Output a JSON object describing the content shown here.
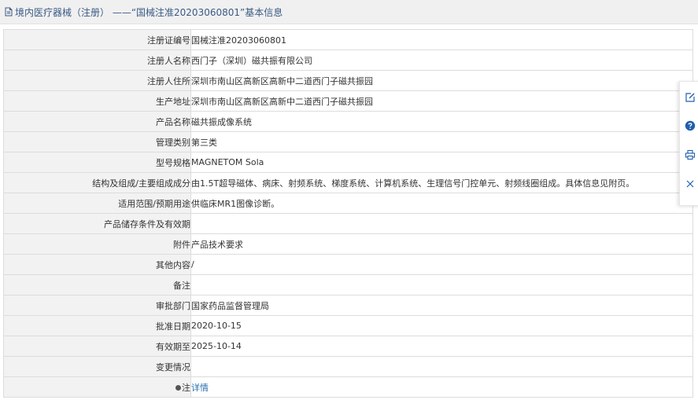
{
  "header": {
    "title": "境内医疗器械（注册） ——“国械注准20203060801”基本信息"
  },
  "rows": [
    {
      "label": "注册证编号",
      "value": "国械注准20203060801"
    },
    {
      "label": "注册人名称",
      "value": "西门子（深圳）磁共振有限公司"
    },
    {
      "label": "注册人住所",
      "value": "深圳市南山区高新区高新中二道西门子磁共振园"
    },
    {
      "label": "生产地址",
      "value": "深圳市南山区高新区高新中二道西门子磁共振园"
    },
    {
      "label": "产品名称",
      "value": "磁共振成像系统"
    },
    {
      "label": "管理类别",
      "value": "第三类"
    },
    {
      "label": "型号规格",
      "value": "MAGNETOM Sola"
    },
    {
      "label": "结构及组成/主要组成成分",
      "value": "由1.5T超导磁体、病床、射频系统、梯度系统、计算机系统、生理信号门控单元、射频线圈组成。具体信息见附页。"
    },
    {
      "label": "适用范围/预期用途",
      "value": "供临床MR1图像诊断。"
    },
    {
      "label": "产品储存条件及有效期",
      "value": ""
    },
    {
      "label": "附件",
      "value": "产品技术要求"
    },
    {
      "label": "其他内容",
      "value": "/"
    },
    {
      "label": "备注",
      "value": ""
    },
    {
      "label": "审批部门",
      "value": "国家药品监督管理局"
    },
    {
      "label": "批准日期",
      "value": "2020-10-15"
    },
    {
      "label": "有效期至",
      "value": "2025-10-14"
    },
    {
      "label": "变更情况",
      "value": ""
    }
  ],
  "note_row": {
    "label": "注",
    "value": "详情"
  },
  "side_panel": {
    "icons": [
      "edit-icon",
      "help-icon",
      "print-icon",
      "close-icon"
    ]
  },
  "colors": {
    "label_bg": "#f2f2f2",
    "border": "#dcdcdc",
    "title_text": "#3a5a86",
    "link": "#2a6fb0",
    "accent_blue": "#1e5fae"
  }
}
